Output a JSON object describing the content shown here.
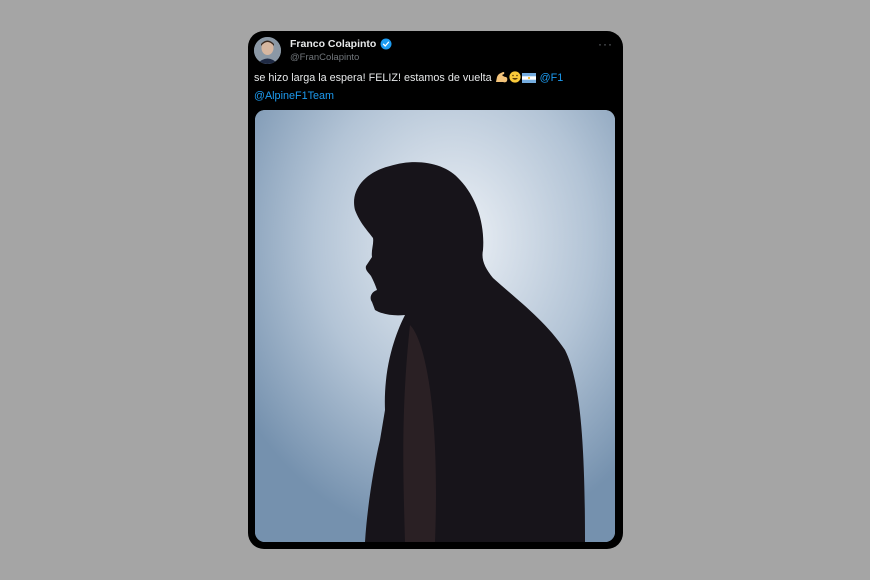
{
  "tweet": {
    "author_name": "Franco Colapinto",
    "author_handle": "@FranColapinto",
    "more_label": "···",
    "text": "se hizo larga la espera! FELIZ! estamos de vuelta",
    "mention_1": "@F1",
    "mention_2": "@AlpineF1Team",
    "emojis": [
      "flexed-biceps-emoji",
      "grinning-face-emoji",
      "argentina-flag-emoji"
    ]
  },
  "colors": {
    "card_background": "#000000",
    "page_background": "#a5a5a5",
    "link": "#1d9bf0",
    "verified_badge": "#1d9bf0",
    "secondary_text": "#71767b"
  }
}
